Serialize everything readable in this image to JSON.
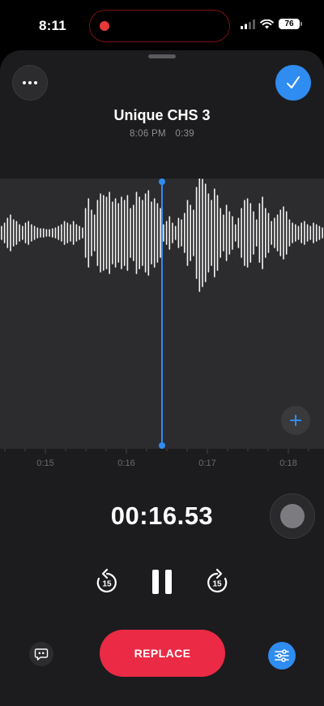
{
  "status_bar": {
    "time": "8:11",
    "battery": "76"
  },
  "recording": {
    "title": "Unique CHS 3",
    "recorded_time": "8:06 PM",
    "duration": "0:39"
  },
  "timeline": {
    "ticks": [
      "0:15",
      "0:16",
      "0:17",
      "0:18"
    ]
  },
  "player": {
    "current_time": "00:16.53"
  },
  "actions": {
    "replace_label": "REPLACE"
  },
  "colors": {
    "accent": "#2f8cf0",
    "record_red": "#eb2a45",
    "sheet_bg": "#1c1c1e",
    "wave_bg": "#2c2c2e"
  },
  "icons": [
    "more-icon",
    "checkmark-icon",
    "plus-icon",
    "skip-back-15-icon",
    "pause-icon",
    "skip-forward-15-icon",
    "transcript-icon",
    "sliders-icon"
  ]
}
